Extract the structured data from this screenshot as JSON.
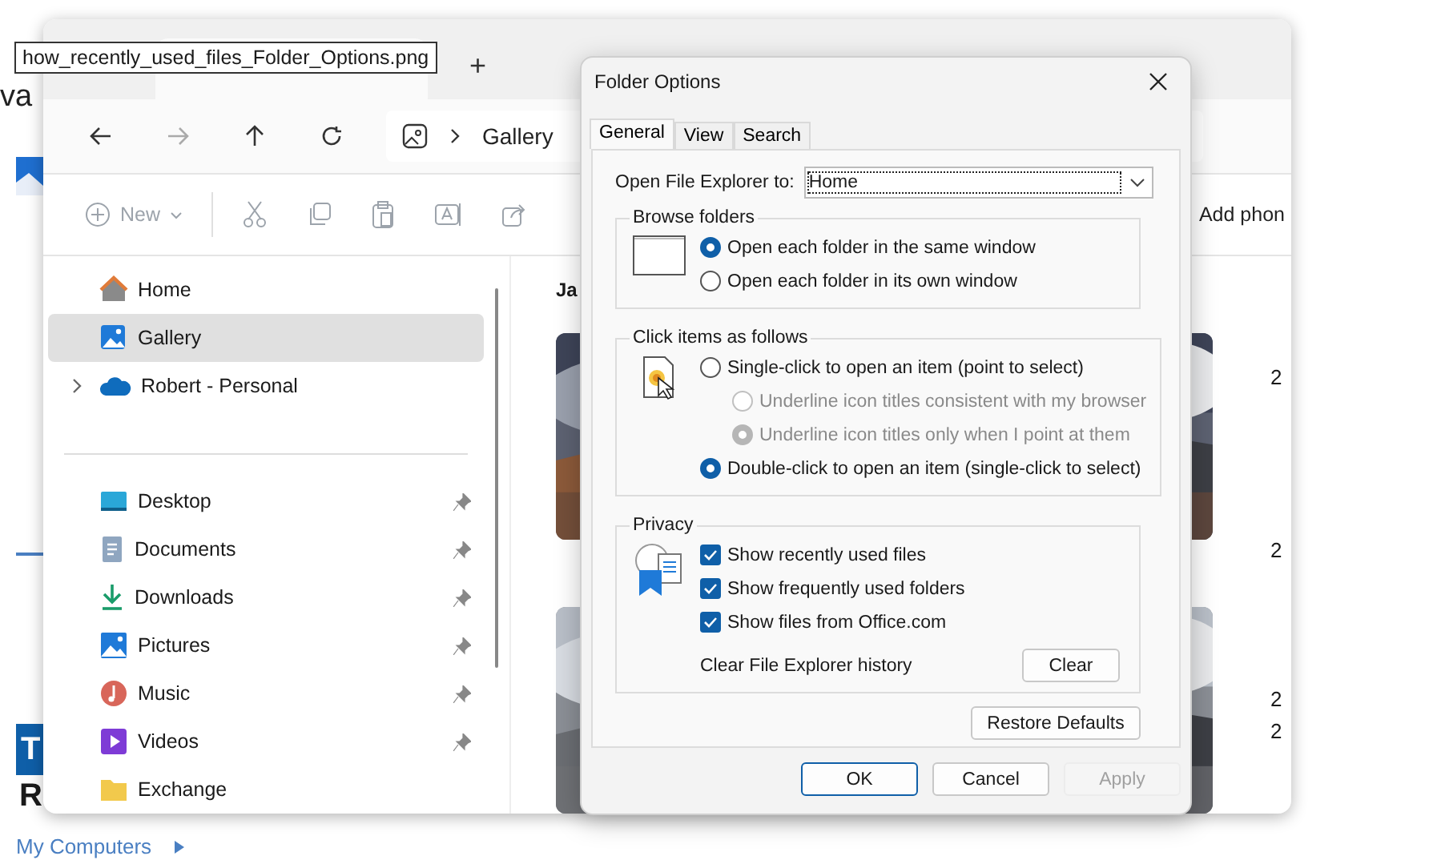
{
  "background": {
    "texts": [
      "va",
      "T",
      "R"
    ],
    "link": "My Computers"
  },
  "tooltip": "how_recently_used_files_Folder_Options.png",
  "explorer": {
    "new_tab": "+",
    "breadcrumb": "Gallery",
    "new_label": "New",
    "toolbar_right": "Add phon",
    "sidebar": [
      {
        "label": "Home",
        "kind": "home",
        "selected": false,
        "pinned": false,
        "expandable": false
      },
      {
        "label": "Gallery",
        "kind": "gallery",
        "selected": true,
        "pinned": false,
        "expandable": false
      },
      {
        "label": "Robert - Personal",
        "kind": "cloud",
        "selected": false,
        "pinned": false,
        "expandable": true
      },
      {
        "label": "Desktop",
        "kind": "desktop",
        "selected": false,
        "pinned": true,
        "expandable": false
      },
      {
        "label": "Documents",
        "kind": "documents",
        "selected": false,
        "pinned": true,
        "expandable": false
      },
      {
        "label": "Downloads",
        "kind": "downloads",
        "selected": false,
        "pinned": true,
        "expandable": false
      },
      {
        "label": "Pictures",
        "kind": "pictures",
        "selected": false,
        "pinned": true,
        "expandable": false
      },
      {
        "label": "Music",
        "kind": "music",
        "selected": false,
        "pinned": true,
        "expandable": false
      },
      {
        "label": "Videos",
        "kind": "videos",
        "selected": false,
        "pinned": true,
        "expandable": false
      },
      {
        "label": "Exchange",
        "kind": "folder",
        "selected": false,
        "pinned": false,
        "expandable": false
      }
    ],
    "content": {
      "heading": "Ja",
      "side_numbers": [
        "2",
        "2",
        "2",
        "2"
      ]
    }
  },
  "dialog": {
    "title": "Folder Options",
    "tabs": [
      {
        "label": "General",
        "selected": true
      },
      {
        "label": "View",
        "selected": false
      },
      {
        "label": "Search",
        "selected": false
      }
    ],
    "open_to": {
      "label": "Open File Explorer to:",
      "value": "Home"
    },
    "browse": {
      "title": "Browse folders",
      "options": [
        {
          "label": "Open each folder in the same window",
          "selected": true,
          "disabled": false
        },
        {
          "label": "Open each folder in its own window",
          "selected": false,
          "disabled": false
        }
      ]
    },
    "click": {
      "title": "Click items as follows",
      "options": [
        {
          "label": "Single-click to open an item (point to select)",
          "selected": false,
          "disabled": false,
          "children": [
            {
              "label": "Underline icon titles consistent with my browser",
              "selected": false,
              "disabled": true
            },
            {
              "label": "Underline icon titles only when I point at them",
              "selected": true,
              "disabled": true
            }
          ]
        },
        {
          "label": "Double-click to open an item (single-click to select)",
          "selected": true,
          "disabled": false
        }
      ]
    },
    "privacy": {
      "title": "Privacy",
      "checks": [
        {
          "label": "Show recently used files",
          "checked": true
        },
        {
          "label": "Show frequently used folders",
          "checked": true
        },
        {
          "label": "Show files from Office.com",
          "checked": true
        }
      ],
      "clear_label": "Clear File Explorer history",
      "clear_button": "Clear"
    },
    "restore": "Restore Defaults",
    "buttons": [
      {
        "label": "OK",
        "default": true,
        "disabled": false
      },
      {
        "label": "Cancel",
        "default": false,
        "disabled": false
      },
      {
        "label": "Apply",
        "default": false,
        "disabled": true
      }
    ]
  }
}
